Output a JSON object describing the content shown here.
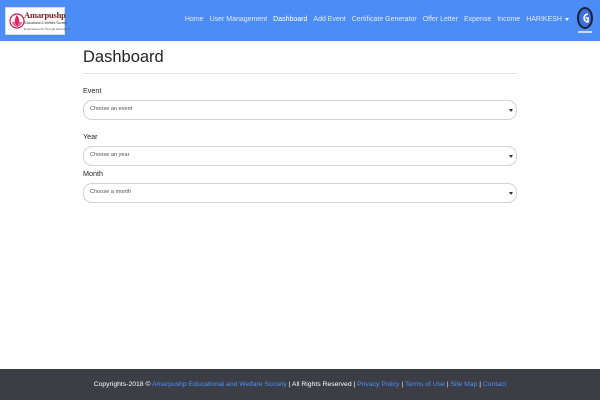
{
  "brand": {
    "name": "Amarpushp",
    "tagline": "Educational & Welfare Society",
    "subtagline": "Empowerment Through Education"
  },
  "nav": {
    "items": [
      {
        "label": "Home"
      },
      {
        "label": "User Management"
      },
      {
        "label": "Dashboard"
      },
      {
        "label": "Add Event"
      },
      {
        "label": "Certificate Generator"
      },
      {
        "label": "Offer Letter"
      },
      {
        "label": "Expense"
      },
      {
        "label": "Income"
      }
    ],
    "active": "Dashboard",
    "user_menu": "HARIKESH"
  },
  "page": {
    "title": "Dashboard"
  },
  "form": {
    "event": {
      "label": "Event",
      "value": "Choose an event"
    },
    "year": {
      "label": "Year",
      "value": "Choose an year"
    },
    "month": {
      "label": "Month",
      "value": "Choose a month"
    }
  },
  "footer": {
    "prefix": "Copyrights-2018 ©",
    "org_link": "Amarpushp Educational and Welfare Society",
    "rights": "| All Rights Reserved |",
    "privacy": "Privacy Policy",
    "sep1": "|",
    "terms": "Terms of Use",
    "sep2": "|",
    "sitemap": "Site Map",
    "sep3": "|",
    "contact": "Contact"
  },
  "colors": {
    "navbar": "#4c8cf5",
    "footer": "#3b3e44",
    "link": "#4d90fe"
  },
  "icons": {
    "brand_logo": "lotus-logo-icon",
    "right_logo": "g-emblem-icon",
    "select_arrow": "chevron-down-icon",
    "user_caret": "caret-down-icon"
  }
}
